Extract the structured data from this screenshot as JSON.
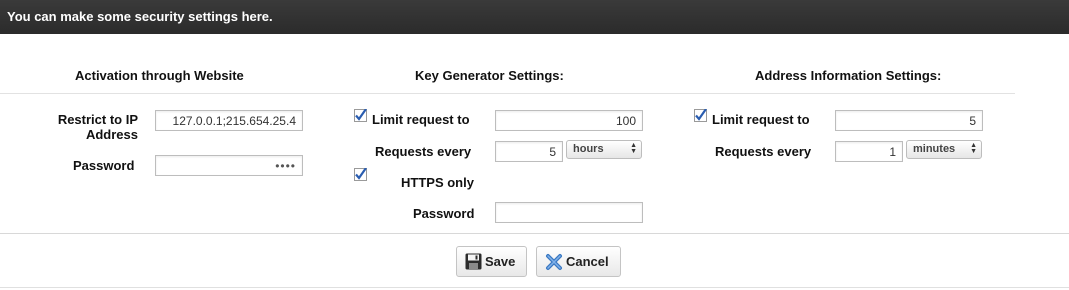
{
  "header": {
    "title": "You can make some security settings here."
  },
  "sections": {
    "activation": {
      "title": "Activation through Website",
      "restrict_ip_label": "Restrict to IP Address",
      "restrict_ip_value": "127.0.0.1;215.654.25.4",
      "password_label": "Password",
      "password_value": "••••"
    },
    "keygen": {
      "title": "Key Generator Settings:",
      "limit_label": "Limit request to",
      "limit_checked": true,
      "limit_value": "100",
      "every_label": "Requests every",
      "every_value": "5",
      "every_unit": "hours",
      "https_label": "HTTPS only",
      "https_checked": true,
      "password_label": "Password",
      "password_value": ""
    },
    "address": {
      "title": "Address Information Settings:",
      "limit_label": "Limit request to",
      "limit_checked": true,
      "limit_value": "5",
      "every_label": "Requests every",
      "every_value": "1",
      "every_unit": "minutes"
    }
  },
  "buttons": {
    "save_label": "Save",
    "cancel_label": "Cancel"
  },
  "icons": {
    "save": "floppy-disk-icon",
    "cancel": "x-icon",
    "checkbox": "checkmark-icon"
  },
  "colors": {
    "header_bg": "#2f2f2f",
    "check": "#2a5db0",
    "cancel_x": "#3a78c2"
  }
}
